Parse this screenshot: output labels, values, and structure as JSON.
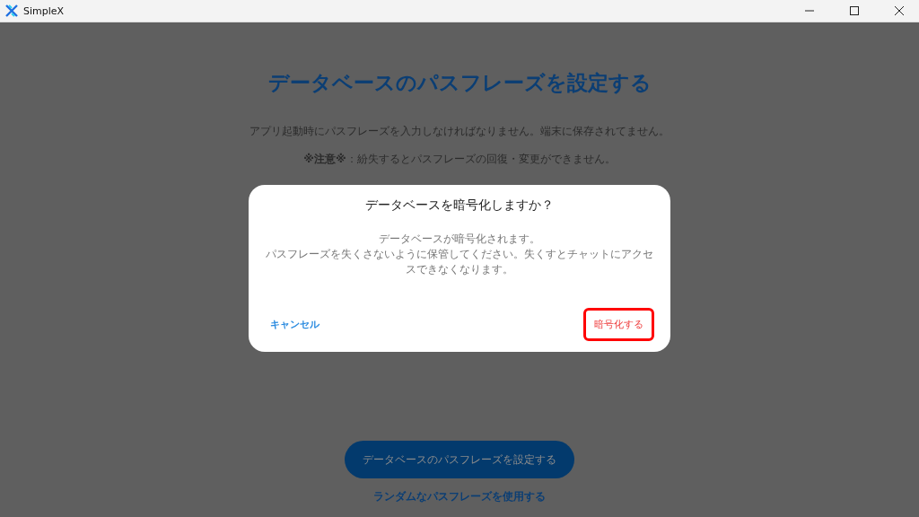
{
  "window": {
    "title": "SimpleX"
  },
  "page": {
    "title": "データベースのパスフレーズを設定する",
    "description": "アプリ起動時にパスフレーズを入力しなければなりません。端末に保存されてません。",
    "warning": "**※注意※**：紛失するとパスフレーズの回復・変更ができません。",
    "primary_button": "データベースのパスフレーズを設定する",
    "random_link": "ランダムなパスフレーズを使用する"
  },
  "dialog": {
    "title": "データベースを暗号化しますか？",
    "message": [
      "データベースが暗号化されます。",
      "パスフレーズを失くさないように保管してください。失くすとチャットにアクセスできなくなります。"
    ],
    "cancel": "キャンセル",
    "confirm": {
      "label": "暗号化する",
      "highlighted": true
    }
  }
}
